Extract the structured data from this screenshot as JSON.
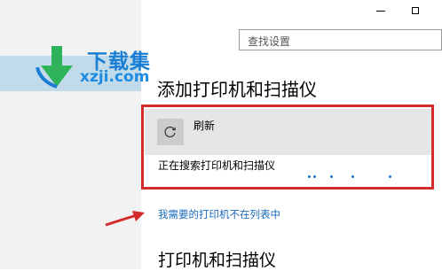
{
  "window": {
    "controls": [
      "minimize",
      "maximize"
    ]
  },
  "search": {
    "placeholder": "查找设置"
  },
  "watermark": {
    "cn": "下载集",
    "url": "xzji.com"
  },
  "page": {
    "title": "添加打印机和扫描仪",
    "refresh": {
      "label": "刷新",
      "icon": "refresh-icon"
    },
    "status": "正在搜索打印机和扫描仪",
    "link": "我需要的打印机不在列表中",
    "section_title": "打印机和扫描仪"
  },
  "colors": {
    "link": "#1a6bbd",
    "highlight_box": "#d42b2b",
    "progress_dots": "#1a73c9",
    "left_pane": "#f2f2f2"
  }
}
